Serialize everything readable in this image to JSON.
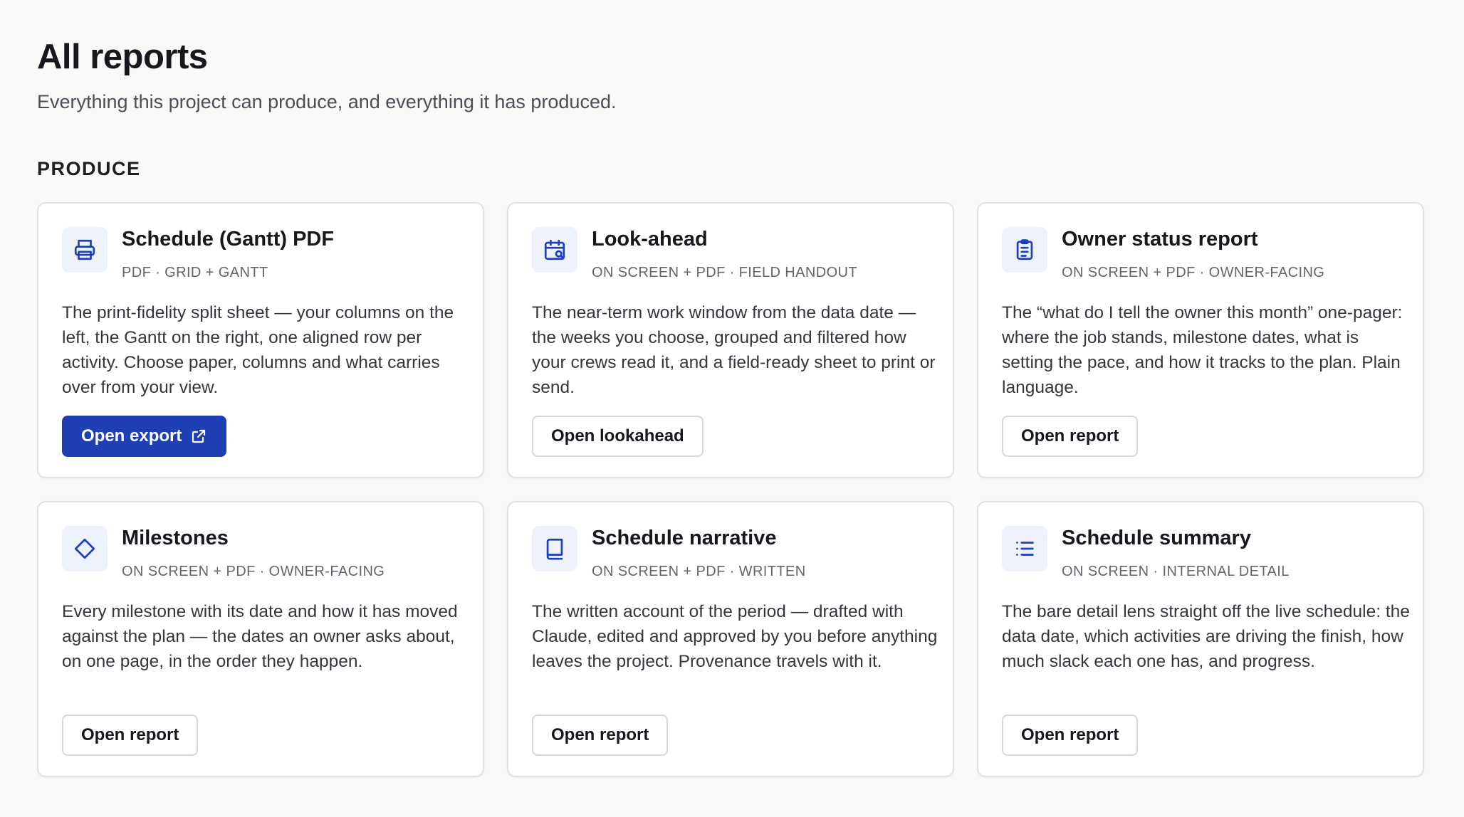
{
  "header": {
    "title": "All reports",
    "subtitle": "Everything this project can produce, and everything it has produced."
  },
  "section": {
    "label": "PRODUCE"
  },
  "cards": [
    {
      "title": "Schedule (Gantt) PDF",
      "meta": "PDF · GRID + GANTT",
      "description": "The print-fidelity split sheet — your columns on the left, the Gantt on the right, one aligned row per activity. Choose paper, columns and what carries over from your view.",
      "button": "Open export",
      "icon": "printer-icon"
    },
    {
      "title": "Look-ahead",
      "meta": "ON SCREEN + PDF · FIELD HANDOUT",
      "description": "The near-term work window from the data date — the weeks you choose, grouped and filtered how your crews read it, and a field-ready sheet to print or send.",
      "button": "Open lookahead",
      "icon": "calendar-search-icon"
    },
    {
      "title": "Owner status report",
      "meta": "ON SCREEN + PDF · OWNER-FACING",
      "description": "The “what do I tell the owner this month” one-pager: where the job stands, milestone dates, what is setting the pace, and how it tracks to the plan. Plain language.",
      "button": "Open report",
      "icon": "clipboard-list-icon"
    },
    {
      "title": "Milestones",
      "meta": "ON SCREEN + PDF · OWNER-FACING",
      "description": "Every milestone with its date and how it has moved against the plan — the dates an owner asks about, on one page, in the order they happen.",
      "button": "Open report",
      "icon": "diamond-icon"
    },
    {
      "title": "Schedule narrative",
      "meta": "ON SCREEN + PDF · WRITTEN",
      "description": "The written account of the period — drafted with Claude, edited and approved by you before anything leaves the project. Provenance travels with it.",
      "button": "Open report",
      "icon": "book-icon"
    },
    {
      "title": "Schedule summary",
      "meta": "ON SCREEN · INTERNAL DETAIL",
      "description": "The bare detail lens straight off the live schedule: the data date, which activities are driving the finish, how much slack each one has, and progress.",
      "button": "Open report",
      "icon": "list-icon"
    }
  ],
  "colors": {
    "accent": "#1f3fb4",
    "icon_tile": "#eef2fb",
    "background": "#f9f9f8"
  }
}
